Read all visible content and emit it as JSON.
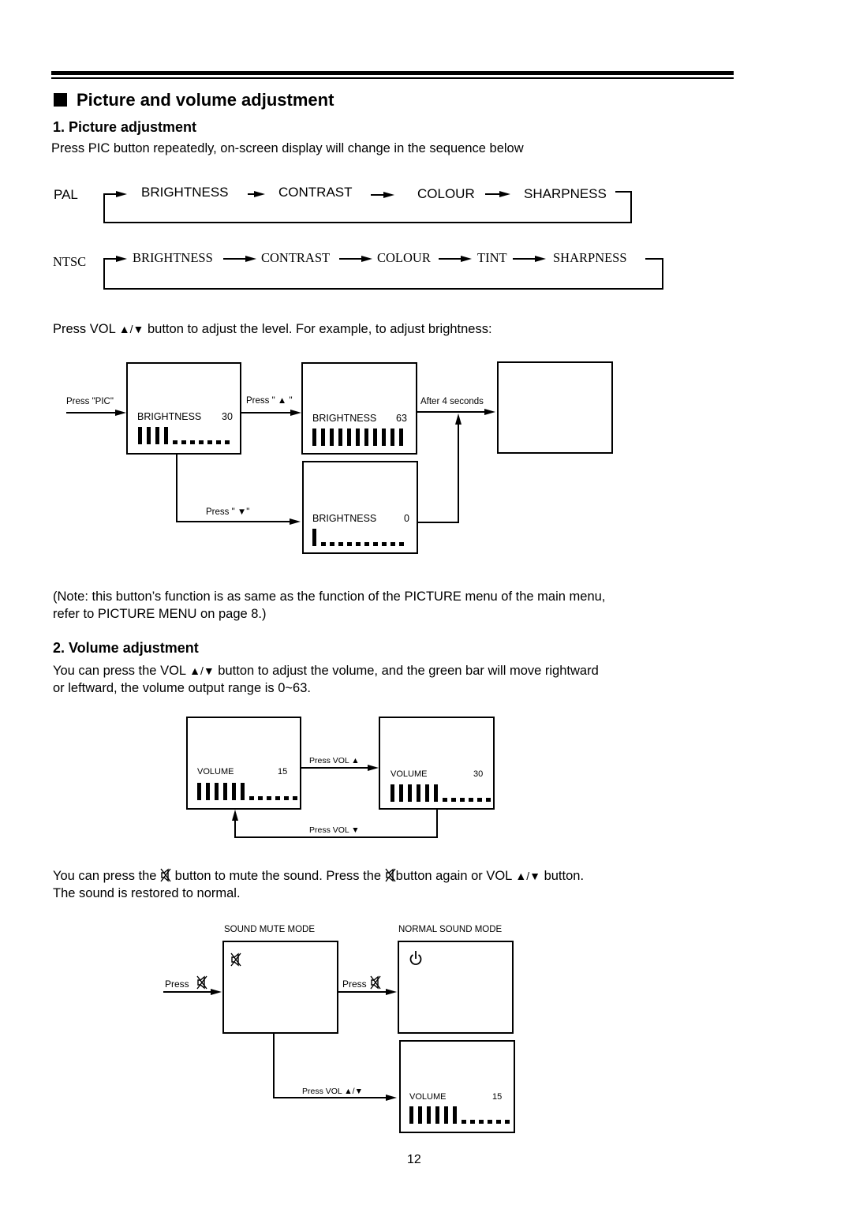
{
  "page": {
    "number": "12",
    "title": "Picture and volume adjustment"
  },
  "picture_section": {
    "heading": "1. Picture adjustment",
    "intro": "Press PIC button repeatedly, on-screen display will change in the sequence below",
    "pal": {
      "label": "PAL",
      "sequence": [
        "BRIGHTNESS",
        "CONTRAST",
        "COLOUR",
        "SHARPNESS"
      ]
    },
    "ntsc": {
      "label": "NTSC",
      "sequence": [
        "BRIGHTNESS",
        "CONTRAST",
        "COLOUR",
        "TINT",
        "SHARPNESS"
      ]
    },
    "vol_instruction_before": "Press VOL",
    "vol_instruction_symbol": "▲/▼",
    "vol_instruction_after": " button to adjust the level. For example, to adjust brightness:",
    "diagram": {
      "press_pic": "Press \"PIC\"",
      "press_up": "Press \" ▲ \"",
      "press_down": "Press \" ▼\"",
      "after_4s": "After 4 seconds",
      "screens": [
        {
          "label": "BRIGHTNESS",
          "value": "30",
          "filled_fraction": 0.36
        },
        {
          "label": "BRIGHTNESS",
          "value": "63",
          "filled_fraction": 1.0
        },
        {
          "label": "BRIGHTNESS",
          "value": "0",
          "filled_fraction": 0.09
        }
      ]
    },
    "note_line1": "(Note: this button’s function is as same as the function of the PICTURE menu of the main menu,",
    "note_line2": "refer to PICTURE MENU on  page 8.)"
  },
  "volume_section": {
    "heading": "2. Volume adjustment",
    "line1_before": "You can press the VOL",
    "line1_symbol": "▲/▼",
    "line1_after": " button to adjust the volume, and the green bar will move rightward",
    "line2": "or leftward, the volume output range is 0~63.",
    "diagram": {
      "press_vol_up": "Press VOL ▲",
      "press_vol_down": "Press VOL ▼",
      "screens": [
        {
          "label": "VOLUME",
          "value": "15",
          "filled_fraction": 0.5
        },
        {
          "label": "VOLUME",
          "value": "30",
          "filled_fraction": 0.5
        }
      ]
    },
    "mute_line1_a": "You can press the",
    "mute_line1_b": " button to mute the sound. Press the",
    "mute_line1_c": "button again or VOL ",
    "mute_line1_symbol": "▲/▼",
    "mute_line1_d": "  button.",
    "mute_line2": "The sound is restored to normal.",
    "mute_diagram": {
      "mute_mode_title": "SOUND MUTE MODE",
      "normal_mode_title": "NORMAL SOUND MODE",
      "press": "Press",
      "press_vol": "Press VOL ▲/▼",
      "volume_screen": {
        "label": "VOLUME",
        "value": "15",
        "filled_fraction": 0.5
      }
    }
  },
  "icons": {
    "mute": "speaker-muted-icon",
    "power": "power-icon",
    "up": "triangle-up-icon",
    "down": "triangle-down-icon"
  }
}
